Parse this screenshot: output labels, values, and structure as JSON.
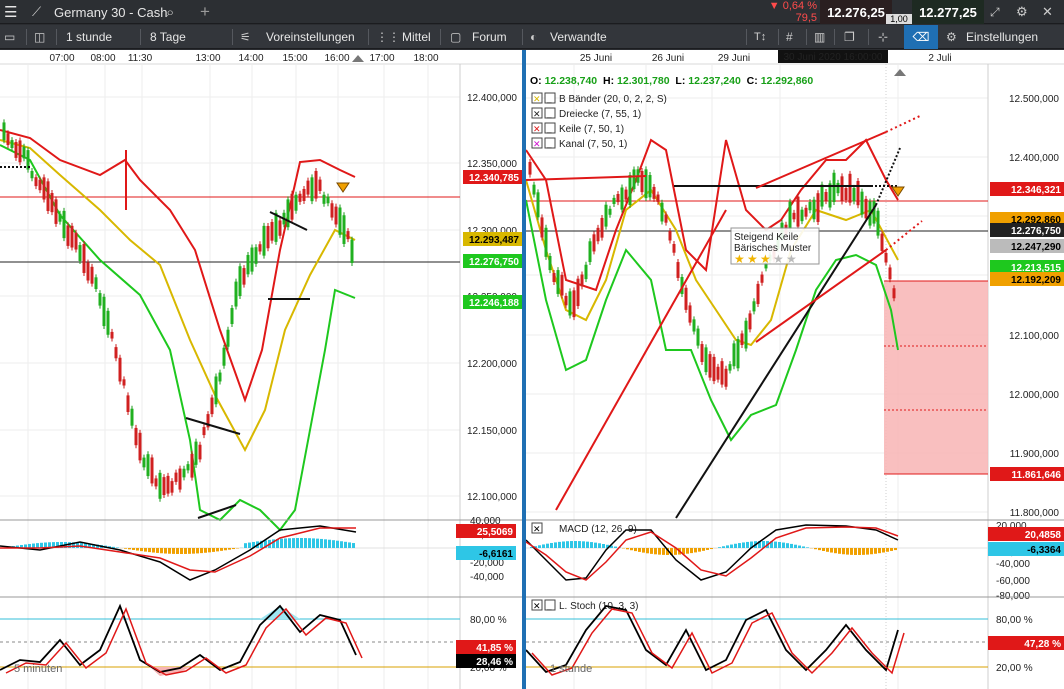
{
  "title": {
    "instrument": "Germany 30 - Cash",
    "change_pct": "0,64 %",
    "change_pts": "79,5",
    "bid": "12.276,25",
    "ask": "12.277,25",
    "spread": "1,00"
  },
  "toolbar": {
    "interval": "1 stunde",
    "period": "8 Tage",
    "presets": "Voreinstellungen",
    "average": "Mittel",
    "forum": "Forum",
    "related": "Verwandte",
    "settings": "Einstellungen"
  },
  "colors": {
    "red": "#e01818",
    "green": "#1ec81e",
    "yellow": "#d8b800",
    "cyan": "#2ec6e6",
    "orange": "#f0a000",
    "pinkzone": "#f8b4b4"
  },
  "left_chart": {
    "time_labels": [
      "07:00",
      "08:00",
      "11:30",
      "13:00",
      "14:00",
      "15:00",
      "16:00",
      "17:00",
      "18:00"
    ],
    "price_axis": [
      "12.400,000",
      "12.350,000",
      "12.300,000",
      "12.250,000",
      "12.200,000",
      "12.150,000",
      "12.100,000"
    ],
    "tags": {
      "upper": "12.340,785",
      "middle": "12.293,487",
      "last": "12.276,750",
      "lower": "12.246,188"
    },
    "macd_axis": [
      "40,000",
      "20,000",
      "-20,000",
      "-40,000"
    ],
    "macd_tags": {
      "line": "25,5069",
      "signal": "-6,6161"
    },
    "stoch_axis": [
      "80,00 %",
      "20,00 %"
    ],
    "stoch_tags": {
      "k": "41,85 %",
      "d": "28,46 %"
    },
    "watermark": "5 minuten"
  },
  "right_chart": {
    "date_labels": [
      "25 Juni",
      "26 Juni",
      "29 Juni",
      "30 Juni 2020 16:00:00",
      "2 Juli"
    ],
    "ohlc": {
      "o_label": "O:",
      "o": "12.238,740",
      "h_label": "H:",
      "h": "12.301,780",
      "l_label": "L:",
      "l": "12.237,240",
      "c_label": "C:",
      "c": "12.292,860"
    },
    "price_axis": [
      "12.500,000",
      "12.400,000",
      "12.300,000",
      "12.200,000",
      "12.100,000",
      "12.000,000",
      "11.900,000",
      "11.800,000"
    ],
    "tags": {
      "t1": "12.346,321",
      "t2": "12.292,860",
      "t3": "12.276,750",
      "t4": "12.247,290",
      "t5": "12.213,515",
      "t6": "12.192,209",
      "t7": "11.861,646"
    },
    "indicators": [
      {
        "label": "B Bänder (20, 0, 2, 2, S)",
        "color": "#d8b800"
      },
      {
        "label": "Dreiecke (7, 55, 1)",
        "color": "#222222"
      },
      {
        "label": "Keile (7, 50, 1)",
        "color": "#e01818"
      },
      {
        "label": "Kanal (7, 50, 1)",
        "color": "#d010d0"
      }
    ],
    "pattern_title": "Steigend Keile",
    "pattern_sub": "Bärisches Muster",
    "macd_label": "MACD (12, 26, 9)",
    "macd_axis": [
      "20,000",
      "-20,000",
      "-40,000",
      "-60,000",
      "-80,000"
    ],
    "macd_tags": {
      "line": "20,4858",
      "signal": "-6,3364"
    },
    "stoch_label": "L. Stoch (10, 3, 3)",
    "stoch_axis": [
      "80,00 %",
      "20,00 %"
    ],
    "stoch_tags": {
      "k": "47,28 %"
    },
    "watermark": "1 stunde"
  }
}
